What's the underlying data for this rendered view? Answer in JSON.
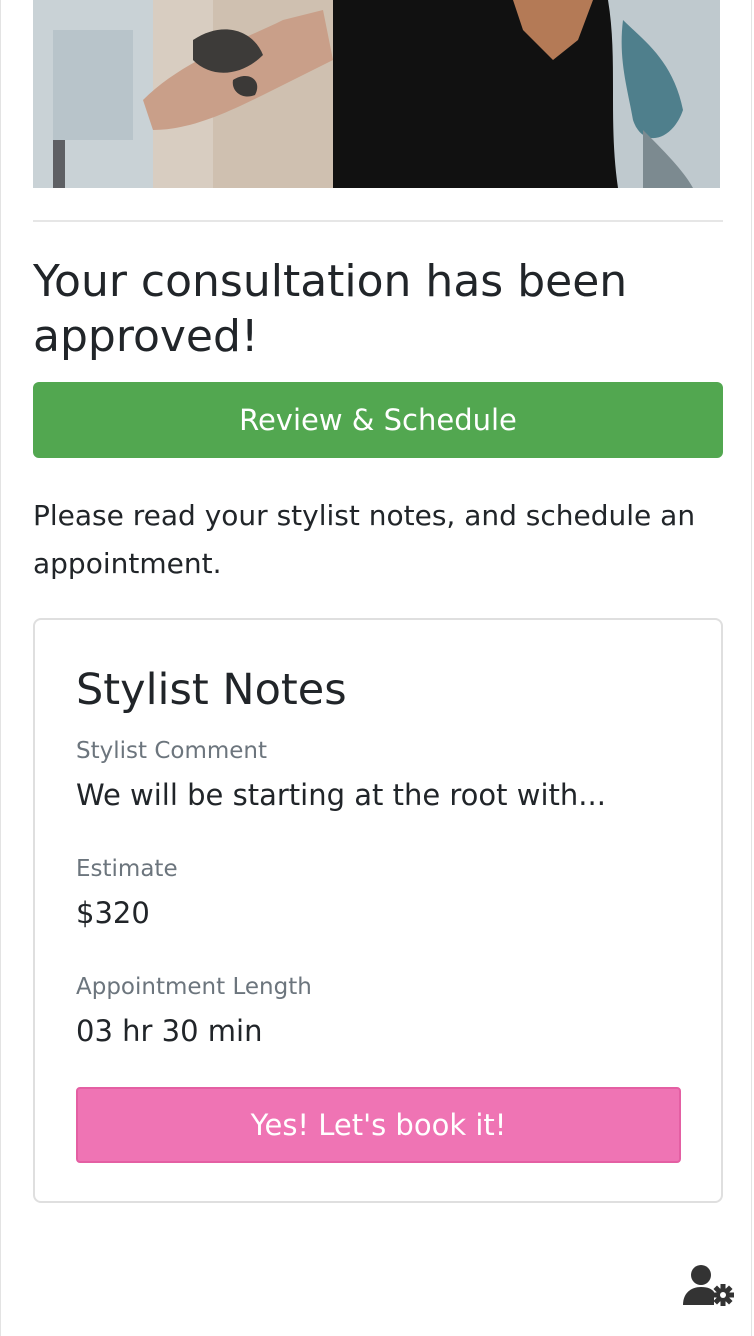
{
  "hero_image": {
    "icon": "salon-photo"
  },
  "consultation": {
    "title": "Your consultation has been approved!",
    "review_button_label": "Review & Schedule",
    "instructions": "Please read your stylist notes, and schedule an appointment.",
    "review_button_color": "#52a750"
  },
  "stylist_notes": {
    "title": "Stylist Notes",
    "comment_label": "Stylist Comment",
    "comment_value": "We will be starting at the root with...",
    "estimate_label": "Estimate",
    "estimate_value": "$320",
    "length_label": "Appointment Length",
    "length_value": "03 hr 30 min",
    "book_button_label": "Yes! Let's book it!",
    "book_button_color": "#ef74b4"
  },
  "footer": {
    "settings_icon": "user-settings-icon"
  }
}
